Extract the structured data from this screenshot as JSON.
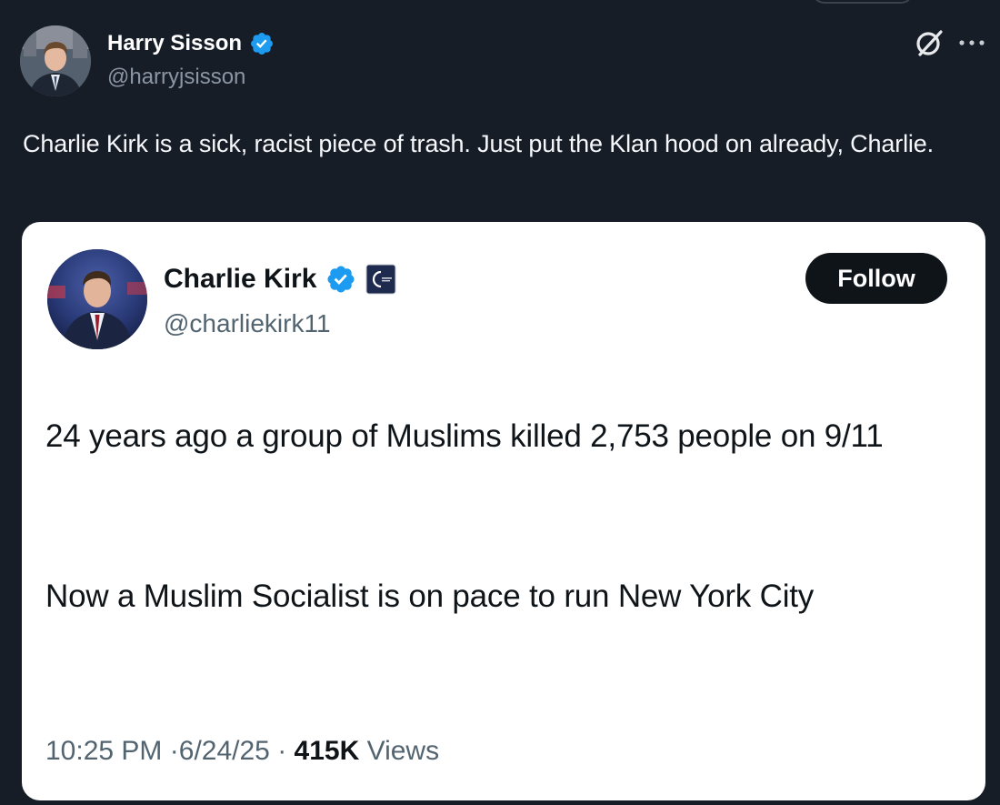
{
  "quote_post": {
    "author": {
      "display_name": "Harry Sisson",
      "handle": "@harryjsisson",
      "verified": true
    },
    "text": "Charlie Kirk is a sick, racist piece of trash. Just put the Klan hood on already, Charlie.",
    "icons": [
      "grok-icon",
      "more-options-icon"
    ]
  },
  "embedded_post": {
    "author": {
      "display_name": "Charlie Kirk",
      "handle": "@charliekirk11",
      "verified": true,
      "affiliation_badge": "organization-badge-icon"
    },
    "follow_label": "Follow",
    "paragraphs": [
      "24 years ago a group of Muslims killed 2,753 people on 9/11",
      "Now a Muslim Socialist is on pace to run New York City"
    ],
    "meta": {
      "time": "10:25 PM",
      "separator": "·",
      "date": "6/24/25",
      "views_count": "415K",
      "views_label": "Views"
    }
  },
  "colors": {
    "background": "#171d27",
    "card_background": "#ffffff",
    "verified_blue": "#1d9bf0",
    "follow_button": "#0f1419"
  }
}
